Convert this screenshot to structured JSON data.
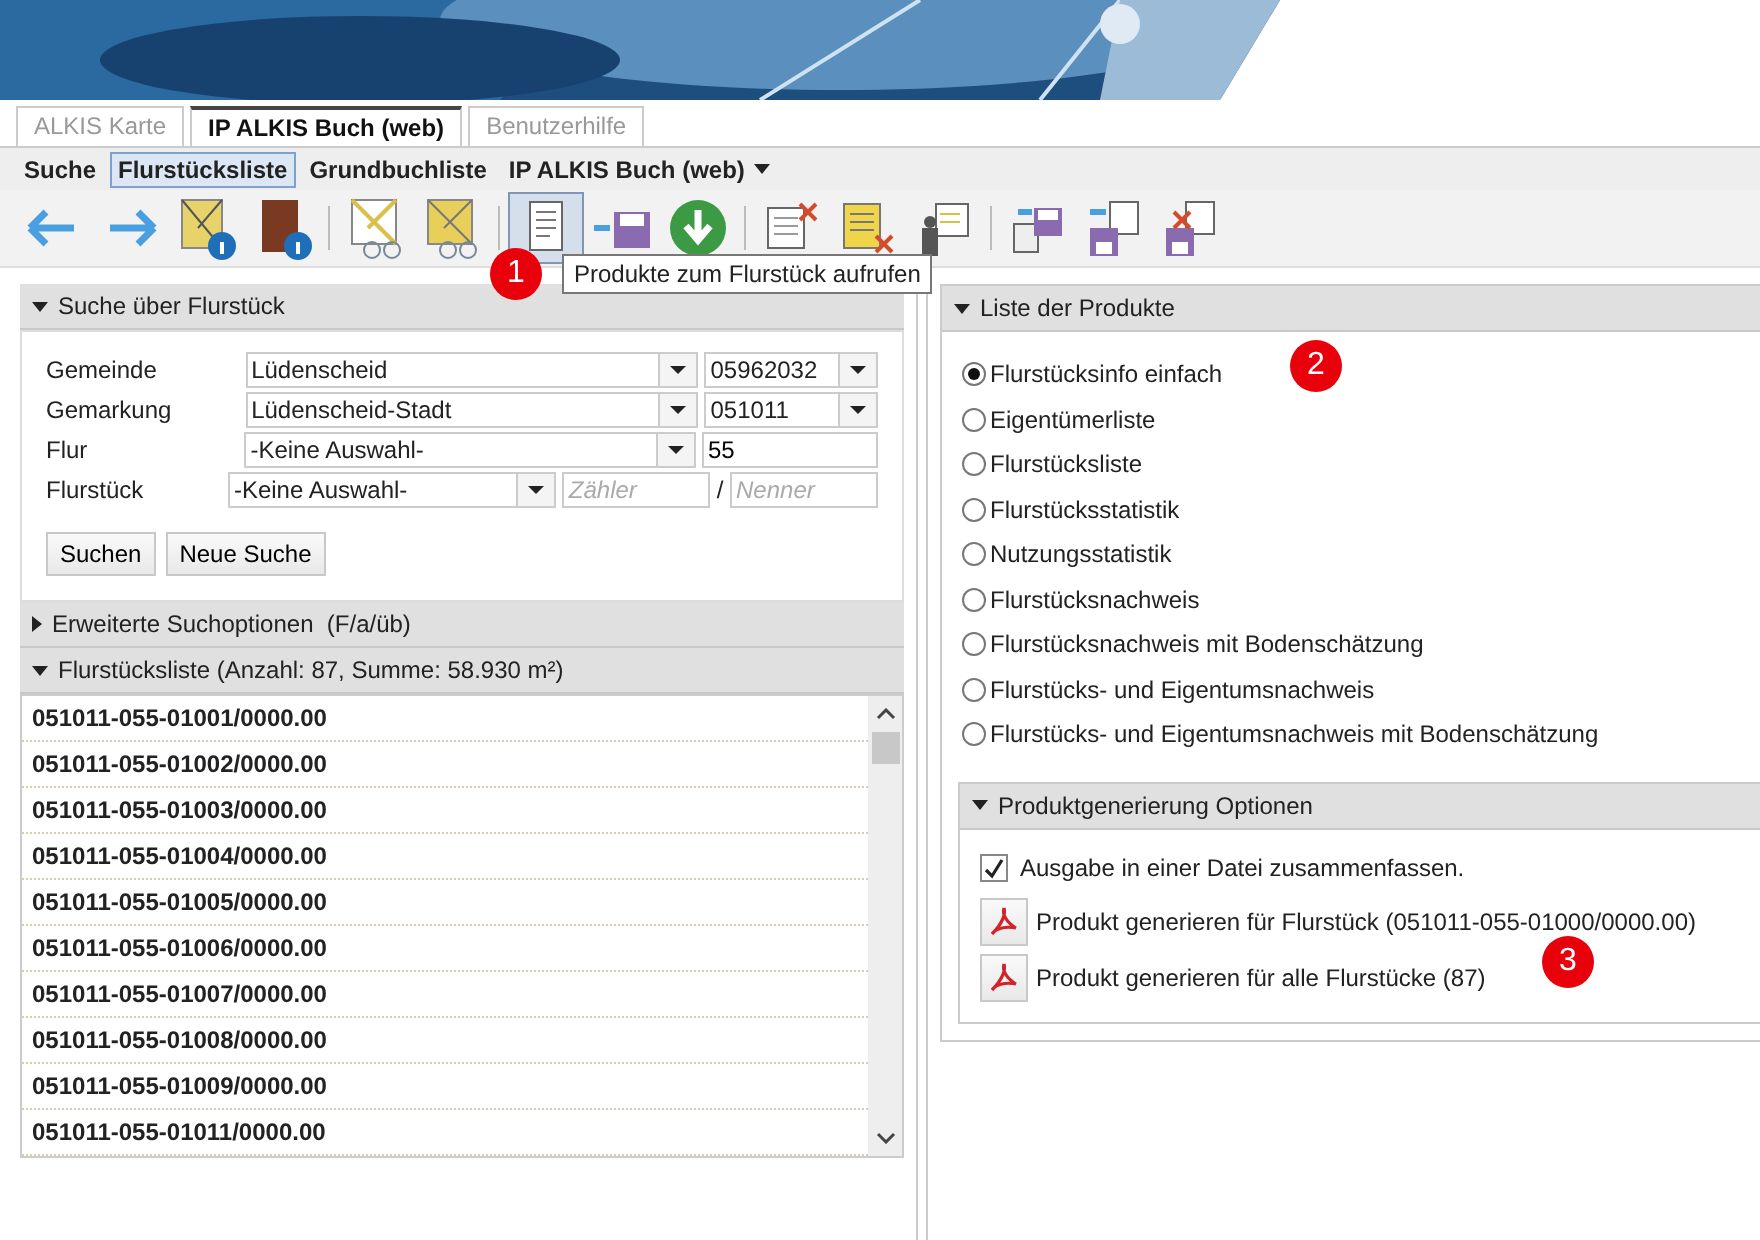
{
  "tabs": [
    {
      "label": "ALKIS Karte",
      "selected": false
    },
    {
      "label": "IP ALKIS Buch (web)",
      "selected": true
    },
    {
      "label": "Benutzerhilfe",
      "selected": false
    }
  ],
  "subnav": [
    {
      "label": "Suche",
      "selected": false,
      "kind": "link"
    },
    {
      "label": "Flurstücksliste",
      "selected": true,
      "kind": "link"
    },
    {
      "label": "Grundbuchliste",
      "selected": false,
      "kind": "link"
    },
    {
      "label": "IP ALKIS Buch (web)",
      "selected": false,
      "kind": "menu"
    }
  ],
  "toolbar": [
    [
      {
        "kind": "back",
        "hovered": false
      },
      {
        "kind": "forward",
        "hovered": false
      },
      {
        "kind": "map-info",
        "hovered": false
      },
      {
        "kind": "book-info",
        "hovered": false
      }
    ],
    [
      {
        "kind": "map-glasses",
        "hovered": false
      },
      {
        "kind": "map-glasses-filled",
        "hovered": false
      }
    ],
    [
      {
        "kind": "document",
        "hovered": true
      },
      {
        "kind": "save-import",
        "hovered": false
      },
      {
        "kind": "download",
        "hovered": false
      }
    ],
    [
      {
        "kind": "list-delete",
        "hovered": false
      },
      {
        "kind": "notepad-delete",
        "hovered": false
      },
      {
        "kind": "person-delete",
        "hovered": false
      }
    ],
    [
      {
        "kind": "save-list",
        "hovered": false
      },
      {
        "kind": "import-save",
        "hovered": false
      },
      {
        "kind": "delete-save",
        "hovered": false
      }
    ]
  ],
  "tooltip": "Produkte zum Flurstück aufrufen",
  "badges": [
    "1",
    "2",
    "3"
  ],
  "search": {
    "title": "Suche über Flurstück",
    "expanded": true,
    "rows": [
      {
        "label": "Gemeinde",
        "select": "Lüdenscheid",
        "code": "05962032",
        "kind": "code-select"
      },
      {
        "label": "Gemarkung",
        "select": "Lüdenscheid-Stadt",
        "code": "051011",
        "kind": "code-select"
      },
      {
        "label": "Flur",
        "select": "-Keine Auswahl-",
        "code": "55",
        "kind": "code-input"
      },
      {
        "label": "Flurstück",
        "select": "-Keine Auswahl-",
        "placeholder_1": "Zähler",
        "separator": "/",
        "placeholder_2": "Nenner",
        "kind": "fraction"
      }
    ],
    "buttons": [
      "Suchen",
      "Neue Suche"
    ]
  },
  "advanced": {
    "title": "Erweiterte Suchoptionen  (F/a/üb)",
    "expanded": false
  },
  "parcel_list": {
    "title": "Flurstücksliste (Anzahl: 87, Summe: 58.930 m²)",
    "expanded": true,
    "items": [
      "051011-055-01001/0000.00",
      "051011-055-01002/0000.00",
      "051011-055-01003/0000.00",
      "051011-055-01004/0000.00",
      "051011-055-01005/0000.00",
      "051011-055-01006/0000.00",
      "051011-055-01007/0000.00",
      "051011-055-01008/0000.00",
      "051011-055-01009/0000.00",
      "051011-055-01011/0000.00"
    ]
  },
  "products": {
    "title": "Liste der Produkte",
    "expanded": true,
    "options": [
      {
        "label": "Flurstücksinfo einfach",
        "selected": true
      },
      {
        "label": "Eigentümerliste",
        "selected": false
      },
      {
        "label": "Flurstücksliste",
        "selected": false
      },
      {
        "label": "Flurstücksstatistik",
        "selected": false
      },
      {
        "label": "Nutzungsstatistik",
        "selected": false
      },
      {
        "label": "Flurstücksnachweis",
        "selected": false
      },
      {
        "label": "Flurstücksnachweis mit Bodenschätzung",
        "selected": false
      },
      {
        "label": "Flurstücks- und Eigentumsnachweis",
        "selected": false
      },
      {
        "label": "Flurstücks- und Eigentumsnachweis mit Bodenschätzung",
        "selected": false
      }
    ]
  },
  "generation": {
    "title": "Produktgenerierung Optionen",
    "expanded": true,
    "checkbox": {
      "label": "Ausgabe in einer Datei zusammenfassen.",
      "checked": true
    },
    "buttons": [
      "Produkt generieren für Flurstück (051011-055-01000/0000.00)",
      "Produkt generieren für alle Flurstücke (87)"
    ]
  }
}
